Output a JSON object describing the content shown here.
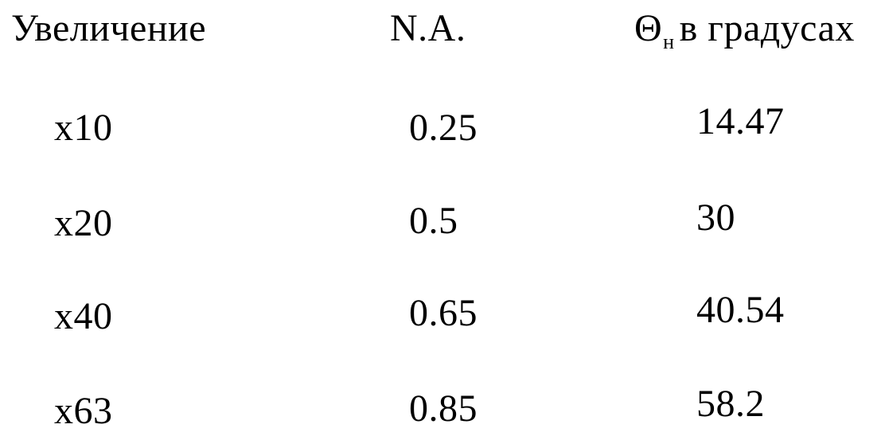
{
  "table": {
    "headers": {
      "magnification": "Увеличение",
      "na": "N.A.",
      "theta_symbol": "Θ",
      "theta_subscript": "н",
      "theta_rest": "в градусах"
    },
    "rows": [
      {
        "magnification": "x10",
        "na": "0.25",
        "theta_deg": "14.47"
      },
      {
        "magnification": "x20",
        "na": "0.5",
        "theta_deg": "30"
      },
      {
        "magnification": "x40",
        "na": "0.65",
        "theta_deg": "40.54"
      },
      {
        "magnification": "x63",
        "na": "0.85",
        "theta_deg": "58.2"
      }
    ]
  }
}
